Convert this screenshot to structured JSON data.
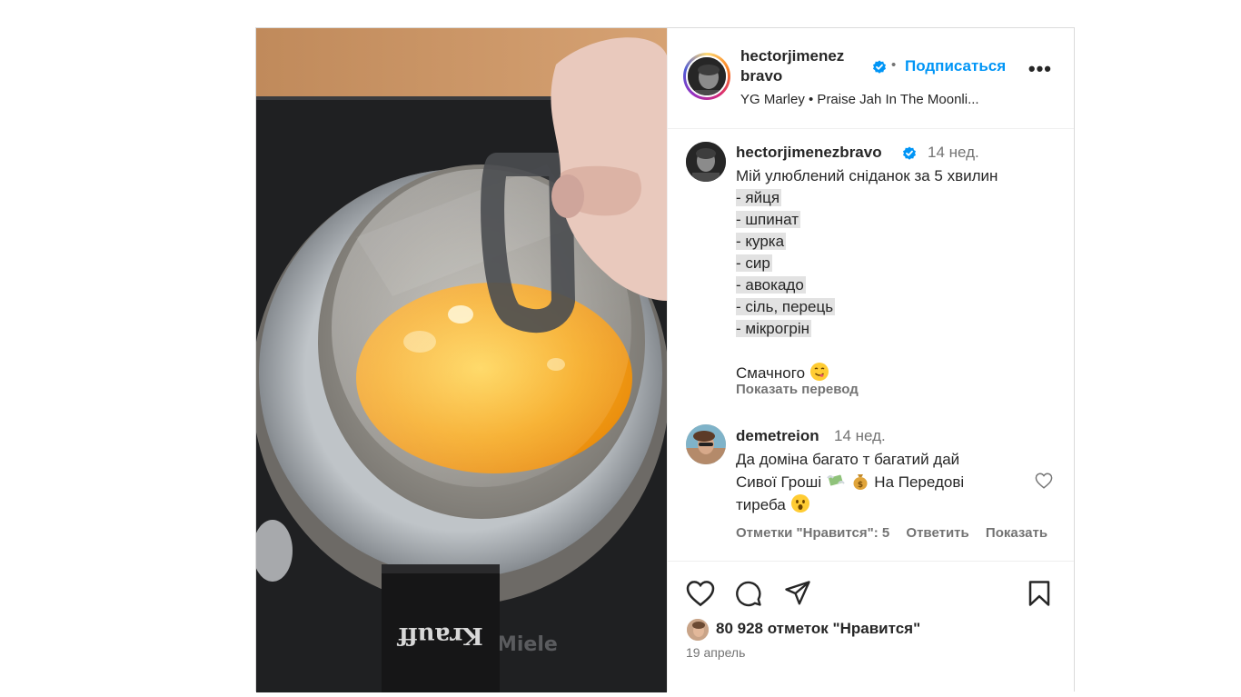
{
  "post": {
    "author": {
      "username_line1": "hectorjimenez",
      "username_line2": "bravo",
      "verified": true,
      "follow_label": "Подписаться",
      "separator": "•",
      "more_label": "•••",
      "audio": "YG Marley • Praise Jah In The Moonli..."
    },
    "caption": {
      "username": "hectorjimenezbravo",
      "time": "14 нед.",
      "title": "Мій улюблений сніданок за 5 хвилин",
      "ingredients": [
        "- яйця",
        "- шпинат",
        "- курка",
        "- сир",
        "- авокадо",
        "- сіль, перець",
        "- мікрогрін"
      ],
      "closing": "Смачного",
      "closing_emoji": "yum-face-emoji",
      "translate_label": "Показать перевод"
    },
    "comment": {
      "username": "demetreion",
      "time": "14 нед.",
      "line1": "Да доміна багато т багатий дай",
      "line2_a": "Сивої Гроші",
      "line2_b": "На Передові",
      "line3": "тиреба",
      "emojis": [
        "money-with-wings-emoji",
        "money-bag-emoji",
        "surprised-face-emoji"
      ],
      "likes_label": "Отметки \"Нравится\": 5",
      "reply_label": "Ответить",
      "show_label": "Показать"
    },
    "footer": {
      "likes": "80 928 отметок \"Нравится\"",
      "date": "19 апрель",
      "icons": [
        "heart-icon",
        "comment-icon",
        "share-icon",
        "bookmark-icon"
      ]
    },
    "media": {
      "stove_brand": "Miele",
      "pan_brand": "Krauff"
    }
  }
}
